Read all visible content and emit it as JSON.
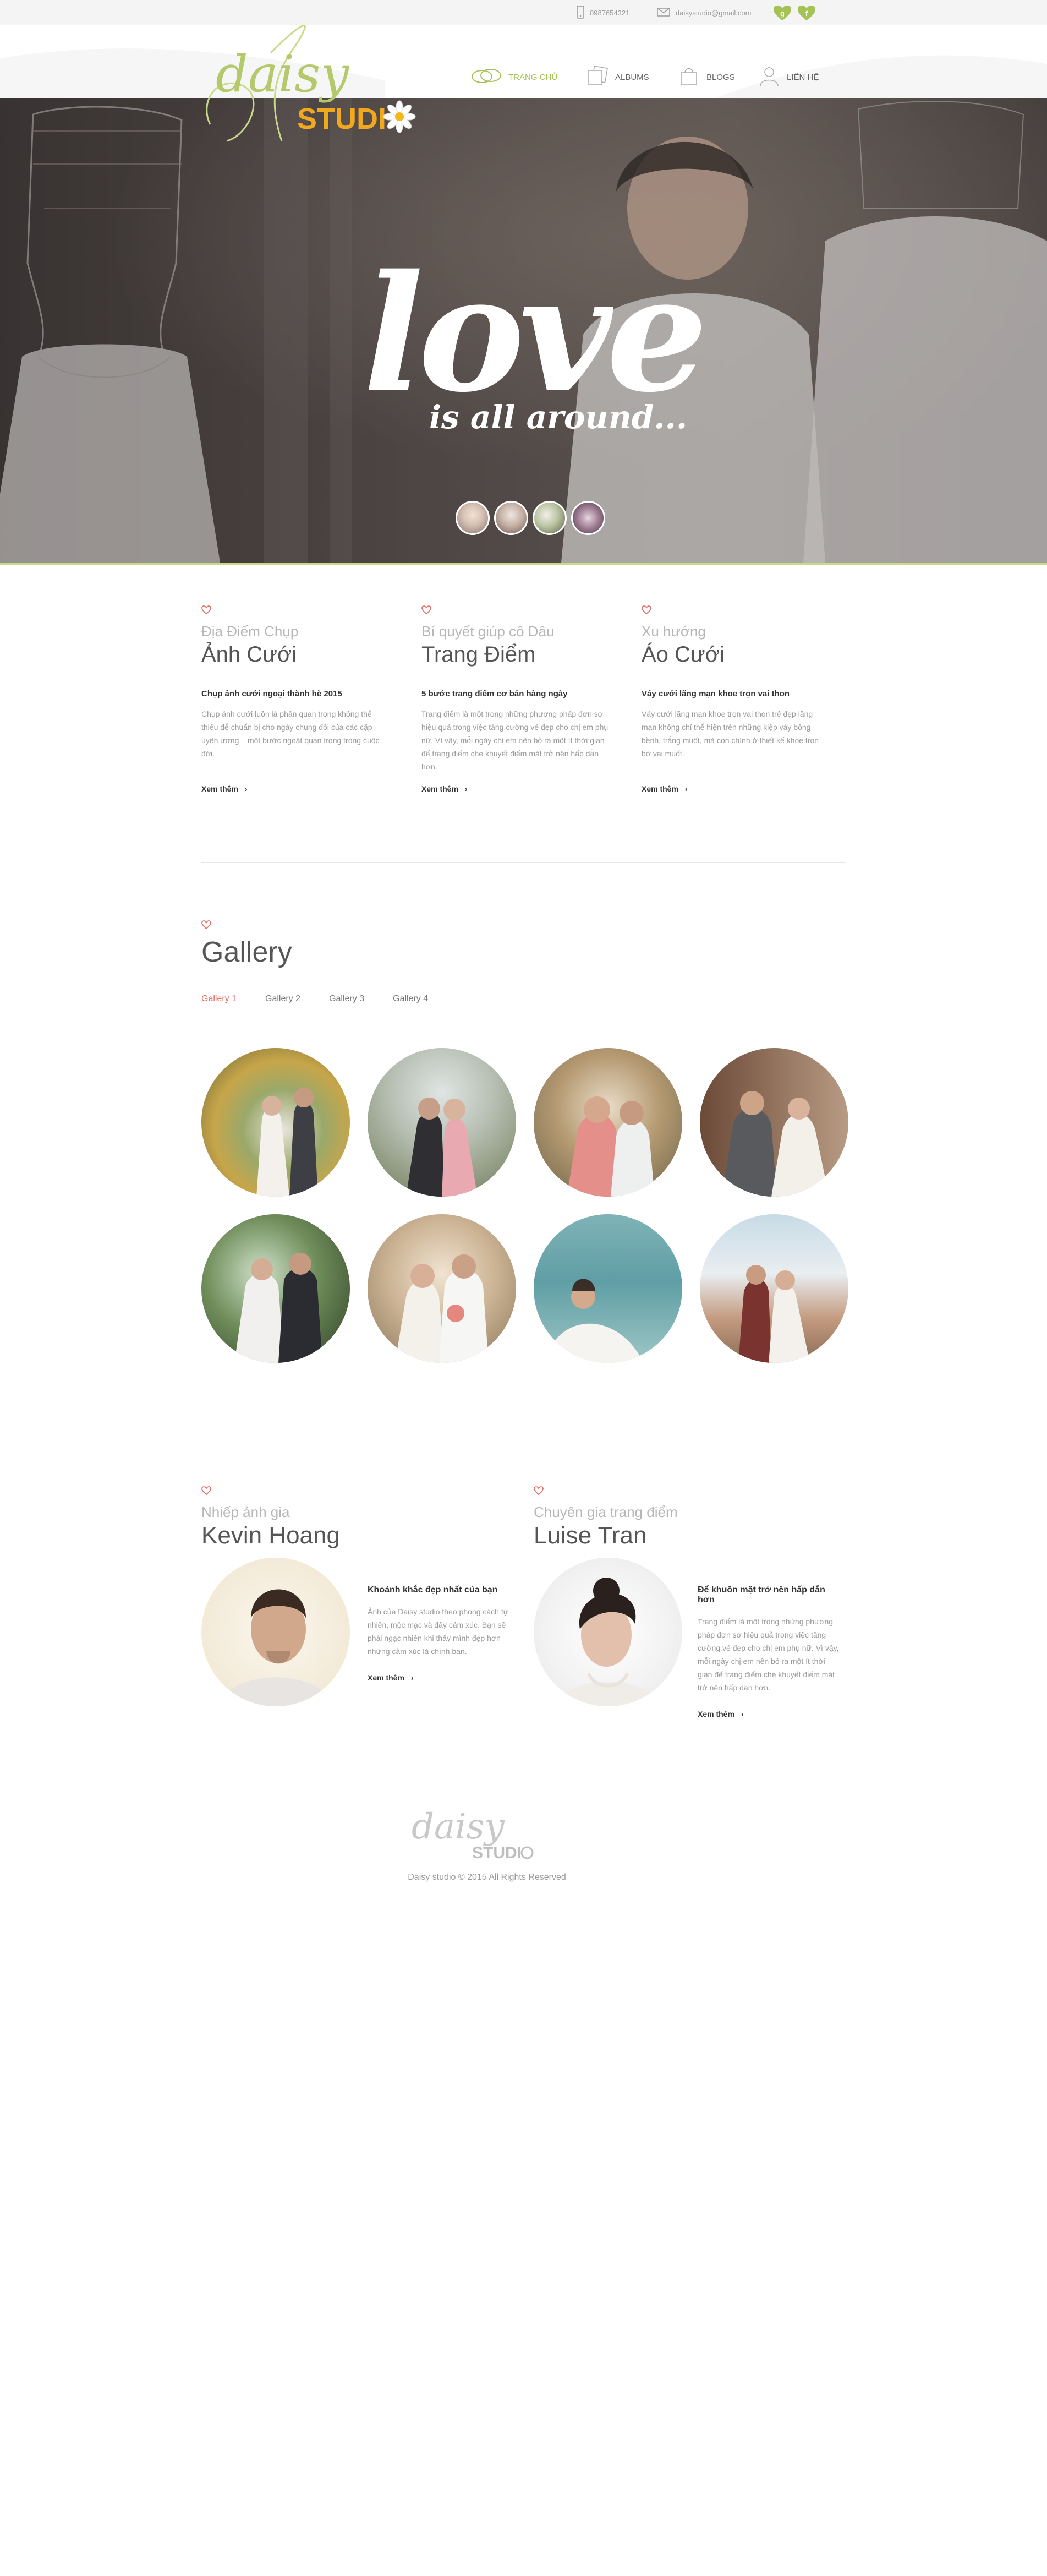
{
  "topbar": {
    "phone": "0987654321",
    "email": "daisystudio@gmail.com",
    "social": [
      {
        "icon": "google-plus-icon",
        "label": "g"
      },
      {
        "icon": "facebook-icon",
        "label": "f"
      }
    ]
  },
  "brand": {
    "logo_script": "daisy",
    "logo_word": "STUDI",
    "accent": "#a5c255",
    "logo_orange": "#f0a81e"
  },
  "nav": [
    {
      "label": "TRANG CHỦ",
      "icon": "rings-icon",
      "active": true
    },
    {
      "label": "ALBUMS",
      "icon": "photos-icon",
      "active": false
    },
    {
      "label": "BLOGS",
      "icon": "bag-icon",
      "active": false
    },
    {
      "label": "LIÊN HỆ",
      "icon": "person-icon",
      "active": false
    }
  ],
  "hero": {
    "headline": "love",
    "tagline": "is all around...",
    "thumbnails": 4
  },
  "features": [
    {
      "eyebrow": "Địa Điểm Chụp",
      "title": "Ảnh Cưới",
      "subtitle": "Chụp ảnh cưới ngoại thành hè 2015",
      "body": "Chụp ảnh cưới luôn là phần quan trọng không thể thiếu để chuẩn bị cho ngày chung đôi của các cặp uyên ương – một bước ngoặt quan trọng trong cuộc đời.",
      "more": "Xem thêm"
    },
    {
      "eyebrow": "Bí quyết giúp cô Dâu",
      "title": "Trang Điểm",
      "subtitle": "5 bước trang điểm cơ bản hàng ngày",
      "body": "Trang điểm là một trong những phương pháp đơn sơ hiệu quả trong việc tăng cường vẻ đẹp cho chị em phụ nữ. Vì vậy, mỗi ngày chị em nên bỏ ra một ít thời gian để trang điểm che khuyết điểm mặt trở nên hấp dẫn hơn.",
      "more": "Xem thêm"
    },
    {
      "eyebrow": "Xu hướng",
      "title": "Áo Cưới",
      "subtitle": "Váy cưới lãng mạn khoe trọn vai thon",
      "body": "Váy cưới lãng mạn khoe trọn vai thon trẻ đẹp lãng mạn không chỉ thể hiện trên những kiệp váy bồng bềnh, trắng muốt, mà còn chính ở thiết kế khoe trọn bờ vai muốt.",
      "more": "Xem thêm"
    }
  ],
  "gallery": {
    "title": "Gallery",
    "tabs": [
      "Gallery 1",
      "Gallery 2",
      "Gallery 3",
      "Gallery 4"
    ],
    "active_tab": "Gallery 1",
    "photo_count": 8
  },
  "team": [
    {
      "eyebrow": "Nhiếp ảnh gia",
      "name": "Kevin Hoang",
      "subtitle": "Khoảnh khắc đẹp nhất của bạn",
      "body": "Ảnh của Daisy studio theo phong cách tự nhiên, mộc mạc và đầy cảm xúc. Bạn sẽ phải ngạc nhiên khi thấy mình đẹp hơn những cảm xúc là chính bạn.",
      "more": "Xem thêm"
    },
    {
      "eyebrow": "Chuyên gia trang điểm",
      "name": "Luise Tran",
      "subtitle": "Để khuôn mặt trở nên hấp dẫn hơn",
      "body": "Trang điểm là một trong những phương pháp đơn sơ hiệu quả trong việc tăng cường vẻ đẹp cho chị em phụ nữ. Vì vậy, mỗi ngày chị em nên bỏ ra một ít thời gian để trang điểm che khuyết điểm mặt trở nên hấp dẫn hơn.",
      "more": "Xem thêm"
    }
  ],
  "footer": {
    "copyright": "Daisy studio © 2015 All Rights Reserved"
  }
}
